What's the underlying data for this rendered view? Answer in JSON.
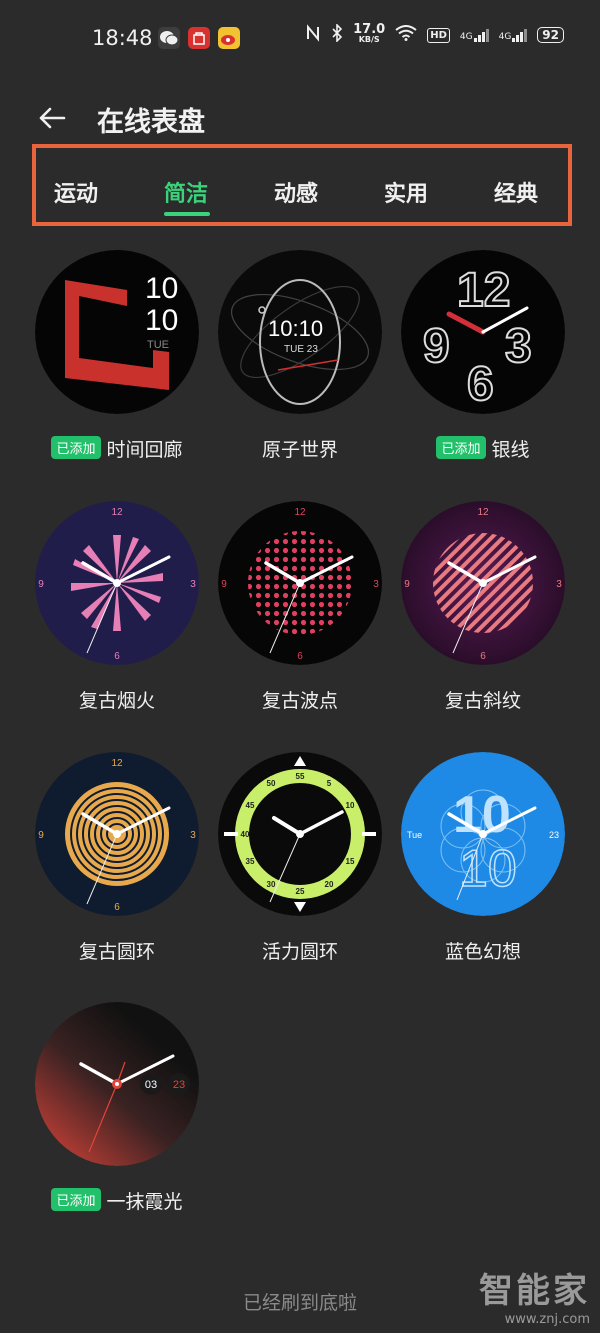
{
  "status": {
    "time": "18:48",
    "speed_value": "17.0",
    "speed_unit": "KB/S",
    "hd": "HD",
    "net1": "4G",
    "net2": "4G",
    "battery": "92"
  },
  "header": {
    "title": "在线表盘"
  },
  "tabs": [
    {
      "label": "运动",
      "active": false
    },
    {
      "label": "简洁",
      "active": true
    },
    {
      "label": "动感",
      "active": false
    },
    {
      "label": "实用",
      "active": false
    },
    {
      "label": "经典",
      "active": false
    }
  ],
  "faces": [
    {
      "name": "时间回廊",
      "added": true,
      "badge": "已添加",
      "hour": "10",
      "minute": "10",
      "day": "TUE"
    },
    {
      "name": "原子世界",
      "added": false,
      "time": "10:10",
      "date": "TUE 23"
    },
    {
      "name": "银线",
      "added": true,
      "badge": "已添加",
      "numerals": [
        "12",
        "9",
        "3",
        "6"
      ]
    },
    {
      "name": "复古烟火",
      "added": false,
      "numerals": [
        "12",
        "9",
        "3",
        "6"
      ]
    },
    {
      "name": "复古波点",
      "added": false,
      "numerals": [
        "12",
        "9",
        "3",
        "6"
      ]
    },
    {
      "name": "复古斜纹",
      "added": false,
      "numerals": [
        "12",
        "9",
        "3",
        "6"
      ]
    },
    {
      "name": "复古圆环",
      "added": false,
      "numerals": [
        "12",
        "9",
        "3",
        "6"
      ]
    },
    {
      "name": "活力圆环",
      "added": false,
      "ring": [
        "5",
        "10",
        "15",
        "20",
        "25",
        "30",
        "35",
        "40",
        "45",
        "50",
        "55"
      ]
    },
    {
      "name": "蓝色幻想",
      "added": false,
      "hour": "10",
      "day": "Tue",
      "date": "23"
    },
    {
      "name": "一抹霞光",
      "added": true,
      "badge": "已添加",
      "hour": "03",
      "date": "23"
    }
  ],
  "footer": {
    "text": "已经刷到底啦"
  },
  "watermark": {
    "main": "智能家",
    "url": "www.znj.com"
  },
  "colors": {
    "accent": "#3ad27a",
    "highlight_box": "#e8643c",
    "badge": "#22c06a"
  }
}
